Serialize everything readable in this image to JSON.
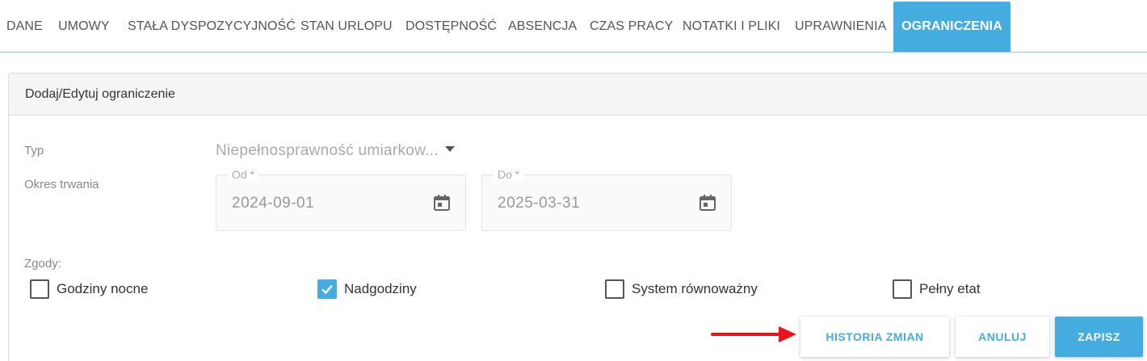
{
  "tabs": [
    {
      "label": "DANE"
    },
    {
      "label": "UMOWY"
    },
    {
      "label": "STAŁA DYSPOZYCYJNOŚĆ"
    },
    {
      "label": "STAN URLOPU"
    },
    {
      "label": "DOSTĘPNOŚĆ"
    },
    {
      "label": "ABSENCJA"
    },
    {
      "label": "CZAS PRACY"
    },
    {
      "label": "NOTATKI I PLIKI"
    },
    {
      "label": "UPRAWNIENIA"
    },
    {
      "label": "OGRANICZENIA",
      "active": true
    }
  ],
  "panel": {
    "title": "Dodaj/Edytuj ograniczenie"
  },
  "form": {
    "type_label": "Typ",
    "type_value": "Niepełnosprawność umiarkow...",
    "period_label": "Okres trwania",
    "from": {
      "label": "Od *",
      "value": "2024-09-01",
      "icon": "calendar-icon"
    },
    "to": {
      "label": "Do *",
      "value": "2025-03-31",
      "icon": "calendar-icon"
    },
    "consents_label": "Zgody:",
    "consents": [
      {
        "label": "Godziny nocne",
        "checked": false
      },
      {
        "label": "Nadgodziny",
        "checked": true
      },
      {
        "label": "System równoważny",
        "checked": false
      },
      {
        "label": "Pełny etat",
        "checked": false
      }
    ]
  },
  "actions": {
    "history_label": "HISTORIA ZMIAN",
    "cancel_label": "ANULUJ",
    "save_label": "ZAPISZ"
  },
  "colors": {
    "accent": "#45ace0",
    "annotation_arrow": "#e8131b"
  }
}
